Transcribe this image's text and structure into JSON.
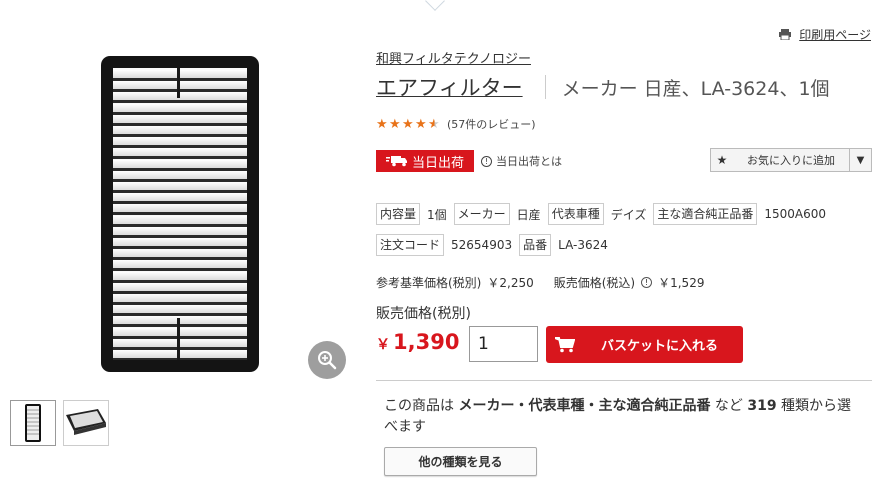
{
  "header": {
    "print_label": "印刷用ページ"
  },
  "product": {
    "brand": "和興フィルタテクノロジー",
    "title": "エアフィルター",
    "subtitle": "メーカー 日産、LA-3624、1個",
    "rating": 4.5,
    "review_count": "(57件のレビュー)"
  },
  "shipping": {
    "badge": "当日出荷",
    "help": "当日出荷とは"
  },
  "favorite": {
    "label": "お気に入りに追加"
  },
  "specs": {
    "row1": [
      {
        "tag": "内容量",
        "value": "1個"
      },
      {
        "tag": "メーカー",
        "value": "日産"
      },
      {
        "tag": "代表車種",
        "value": "デイズ"
      },
      {
        "tag": "主な適合純正品番",
        "value": "1500A600"
      }
    ],
    "row2": [
      {
        "tag": "注文コード",
        "value": "52654903"
      },
      {
        "tag": "品番",
        "value": "LA-3624"
      }
    ]
  },
  "pricing": {
    "ref_label": "参考基準価格(税別)",
    "ref_value": "￥2,250",
    "tax_label": "販売価格(税込)",
    "tax_value": "￥1,529",
    "sale_label": "販売価格(税別)",
    "sale_symbol": "￥",
    "sale_value": "1,390"
  },
  "cart": {
    "quantity": "1",
    "button_label": "バスケットに入れる"
  },
  "variants": {
    "prefix": "この商品は ",
    "bold1": "メーカー・代表車種・主な適合純正品番",
    "mid": " など ",
    "count": "319",
    "suffix": " 種類から選べます",
    "button_label": "他の種類を見る"
  },
  "colors": {
    "accent": "#d8161d",
    "star": "#e8731a"
  }
}
